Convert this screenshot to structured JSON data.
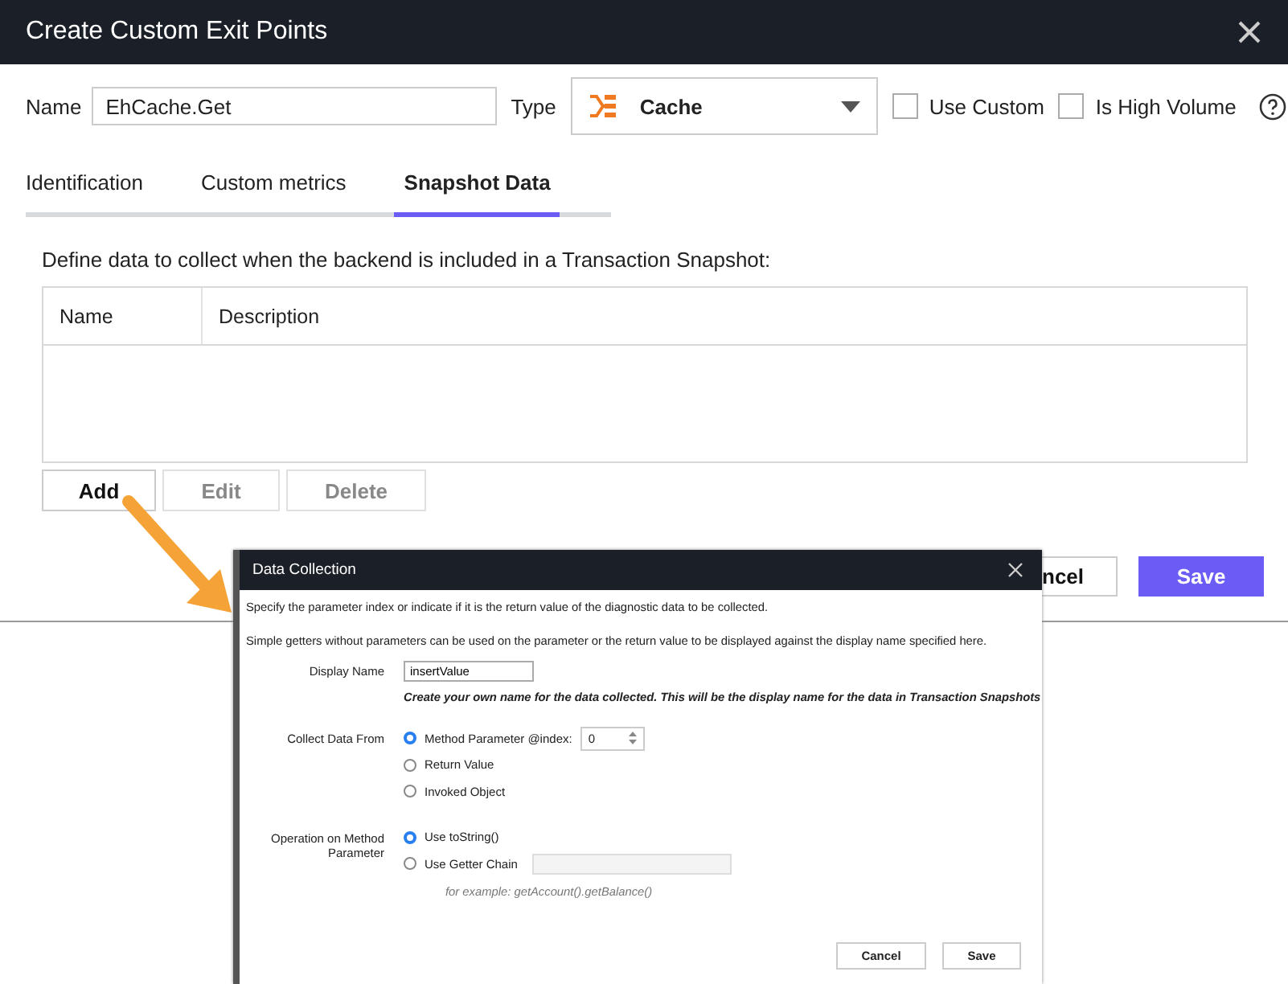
{
  "dialog": {
    "title": "Create Custom Exit Points",
    "name_field": {
      "label": "Name",
      "value": "EhCache.Get"
    },
    "type_field": {
      "label": "Type",
      "value": "Cache"
    },
    "checkboxes": [
      {
        "label": "Use Custom",
        "checked": false
      },
      {
        "label": "Is High Volume",
        "checked": false
      }
    ],
    "tabs": [
      {
        "label": "Identification",
        "selected": false
      },
      {
        "label": "Custom metrics",
        "selected": false
      },
      {
        "label": "Snapshot Data",
        "selected": true
      }
    ],
    "instruction": "Define data to collect when the backend is included in a Transaction Snapshot:",
    "table": {
      "columns": [
        "Name",
        "Description"
      ]
    },
    "table_buttons": [
      {
        "label": "Add",
        "disabled": false
      },
      {
        "label": "Edit",
        "disabled": true
      },
      {
        "label": "Delete",
        "disabled": true
      }
    ],
    "footer_buttons": [
      {
        "label": "ncel",
        "kind": "secondary"
      },
      {
        "label": "Save",
        "kind": "primary"
      }
    ]
  },
  "data_collection": {
    "title": "Data Collection",
    "intro": [
      "Specify the parameter index or indicate if it is the return value of the diagnostic data to be collected.",
      "Simple getters without parameters can be used on the parameter or the return value to be displayed against the display name specified here."
    ],
    "display_name": {
      "label": "Display Name",
      "value": "insertValue",
      "hint": "Create your own name for the data collected. This will be the display name for the data in Transaction Snapshots"
    },
    "collect_from": {
      "label": "Collect Data From",
      "options": [
        {
          "label": "Method Parameter @index:",
          "selected": true,
          "kind": "index",
          "value": "0"
        },
        {
          "label": "Return Value",
          "selected": false,
          "kind": "plain"
        },
        {
          "label": "Invoked Object",
          "selected": false,
          "kind": "plain"
        }
      ]
    },
    "operation": {
      "label": "Operation on Method Parameter",
      "options": [
        {
          "label": "Use toString()",
          "selected": true,
          "kind": "plain"
        },
        {
          "label": "Use Getter Chain",
          "selected": false,
          "kind": "getter"
        }
      ],
      "example": "for example: getAccount().getBalance()"
    },
    "buttons": [
      "Cancel",
      "Save"
    ]
  }
}
